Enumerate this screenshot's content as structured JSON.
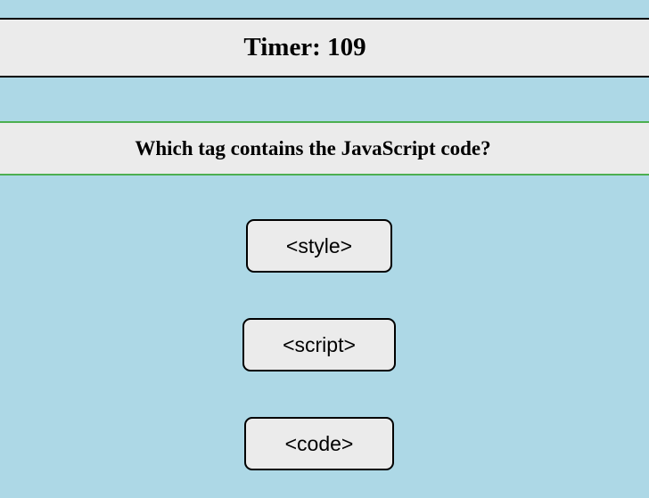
{
  "timer": {
    "label": "Timer:",
    "value": "109"
  },
  "question": {
    "text": "Which tag contains the JavaScript code?"
  },
  "answers": [
    {
      "label": "<style>"
    },
    {
      "label": "<script>"
    },
    {
      "label": "<code>"
    }
  ],
  "colors": {
    "page_background": "#add8e6",
    "bar_background": "#ebebeb",
    "question_border": "#4caf50",
    "timer_border": "#000000"
  }
}
